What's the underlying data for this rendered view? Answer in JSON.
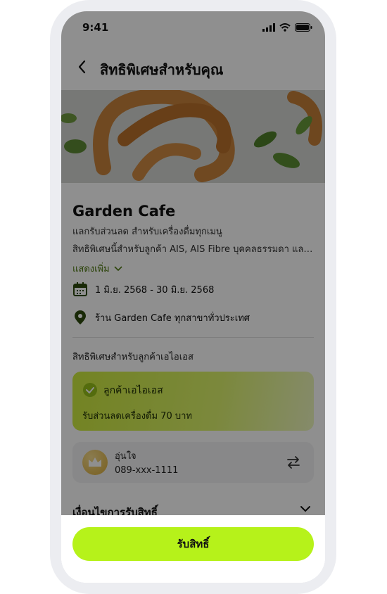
{
  "status_bar": {
    "time": "9:41"
  },
  "header": {
    "title": "สิทธิพิเศษสำหรับคุณ"
  },
  "offer": {
    "name": "Garden Cafe",
    "subtitle": "แลกรับส่วนลด สำหรับเครื่องดื่มทุกเมนู",
    "description": "สิทธิพิเศษนี้สำหรับลูกค้า AIS, AIS Fibre บุคคลธรรมดา และนิติบุคคล",
    "show_more": "แสดงเพิ่ม",
    "date_range": "1 มิ.ย. 2568 - 30 มิ.ย. 2568",
    "location": "ร้าน Garden Cafe ทุกสาขาทั่วประเทศ"
  },
  "privilege": {
    "section_title": "สิทธิพิเศษสำหรับลูกค้าเอไอเอส",
    "tier": "ลูกค้าเอไอเอส",
    "benefit": "รับส่วนลดเครื่องดื่ม 70 บาท"
  },
  "account": {
    "name": "อุ่นใจ",
    "number": "089-xxx-1111"
  },
  "conditions": {
    "label": "เงื่อนไขการรับสิทธิ์"
  },
  "footer": {
    "claim_label": "รับสิทธิ์"
  },
  "colors": {
    "accent": "#b6f21a",
    "link_green": "#4f7a12",
    "overlay": "rgba(0,0,0,0.44)"
  },
  "icons": [
    "back-chevron-icon",
    "calendar-icon",
    "location-pin-icon",
    "check-circle-icon",
    "crown-icon",
    "swap-icon",
    "chevron-down-icon",
    "signal-icon",
    "wifi-icon",
    "battery-icon"
  ]
}
